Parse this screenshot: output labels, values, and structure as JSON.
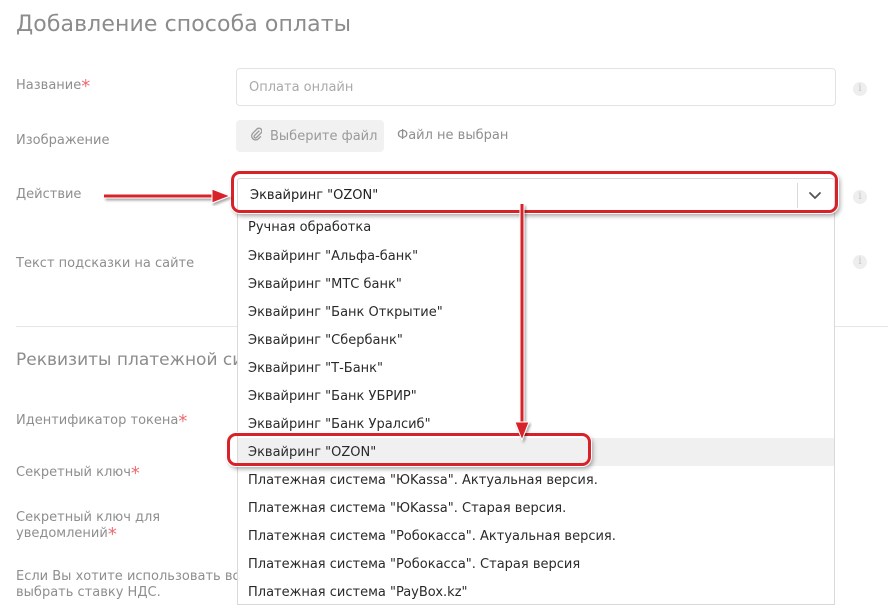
{
  "title": "Добавление способа оплаты",
  "form": {
    "name_label": "Название",
    "name_placeholder": "Оплата онлайн",
    "image_label": "Изображение",
    "file_button_label": "Выберите файл",
    "file_status": "Файл не выбран",
    "action_label": "Действие",
    "action_selected": "Эквайринг \"OZON\"",
    "hint_label": "Текст подсказки на сайте"
  },
  "section": {
    "title": "Реквизиты платежной сист",
    "token_label": "Идентификатор токена",
    "secret_label": "Секретный ключ",
    "secret_notify_label_line1": "Секретный ключ для",
    "secret_notify_label_line2": "уведомлений",
    "vat_label_line1": "Если Вы хотите использовать возм",
    "vat_label_line2": "выбрать ставку НДС."
  },
  "dropdown": {
    "options": [
      "Ручная обработка",
      "Эквайринг \"Альфа-банк\"",
      "Эквайринг \"МТС банк\"",
      "Эквайринг \"Банк Открытие\"",
      "Эквайринг \"Сбербанк\"",
      "Эквайринг \"Т-Банк\"",
      "Эквайринг \"Банк УБРИР\"",
      "Эквайринг \"Банк Уралсиб\"",
      "Эквайринг \"OZON\"",
      "Платежная система \"ЮKassa\". Актуальная версия.",
      "Платежная система \"ЮKassa\". Старая версия.",
      "Платежная система \"Робокасса\". Актуальная версия.",
      "Платежная система \"Робокасса\". Старая версия",
      "Платежная система \"PayBox.kz\""
    ],
    "highlighted_index": 8
  },
  "icons": {
    "info": "info-icon",
    "paperclip": "paperclip-icon",
    "chevron": "chevron-down-icon"
  },
  "colors": {
    "annotation": "#d8222a",
    "required": "#ef6b73"
  },
  "required_mark": "*",
  "info_glyph": "i"
}
